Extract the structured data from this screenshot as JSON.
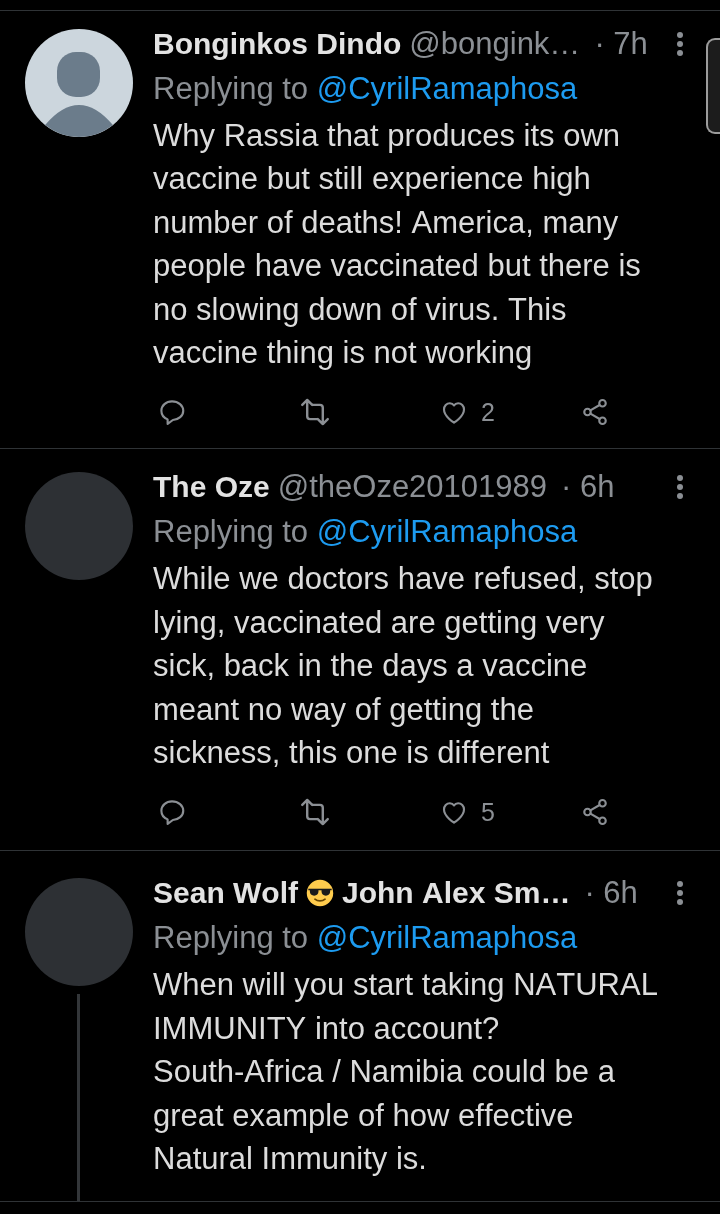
{
  "tweets": [
    {
      "avatar": {
        "kind": "silhouette"
      },
      "name_parts": [
        {
          "kind": "text",
          "text": "Bonginkos Dindo"
        }
      ],
      "handle": "@bongink…",
      "time": "· 7h",
      "reply_to": {
        "prefix": "Replying to",
        "mention": "@CyrilRamaphosa"
      },
      "text": "Why Rassia that produces its own vaccine but still experience high number of deaths! America, many people have vaccinated but there is no slowing down of virus. This vaccine thing is not working",
      "thread_line": false,
      "actions": {
        "likes": "2",
        "liked": false
      }
    },
    {
      "avatar": {
        "kind": "blank"
      },
      "name_parts": [
        {
          "kind": "text",
          "text": "The Oze"
        }
      ],
      "handle": "@theOze20101989",
      "time": "· 6h",
      "reply_to": {
        "prefix": "Replying to",
        "mention": "@CyrilRamaphosa"
      },
      "text": "While we doctors have refused, stop lying, vaccinated are getting very sick, back in the days a vaccine meant no way of getting the sickness, this one is different",
      "thread_line": false,
      "actions": {
        "likes": "5",
        "liked": false
      }
    },
    {
      "avatar": {
        "kind": "blank"
      },
      "name_parts": [
        {
          "kind": "text",
          "text": "Sean Wolf"
        },
        {
          "kind": "emoji"
        },
        {
          "kind": "text",
          "text": "John Alex Sm…"
        }
      ],
      "time": "· 6h",
      "reply_to": {
        "prefix": "Replying to",
        "mention": "@CyrilRamaphosa"
      },
      "text": "When will you start taking NATURAL IMMUNITY into account? South-Africa / Namibia could be a great example of how effective Natural Immunity is.",
      "thread_line": true
    }
  ]
}
